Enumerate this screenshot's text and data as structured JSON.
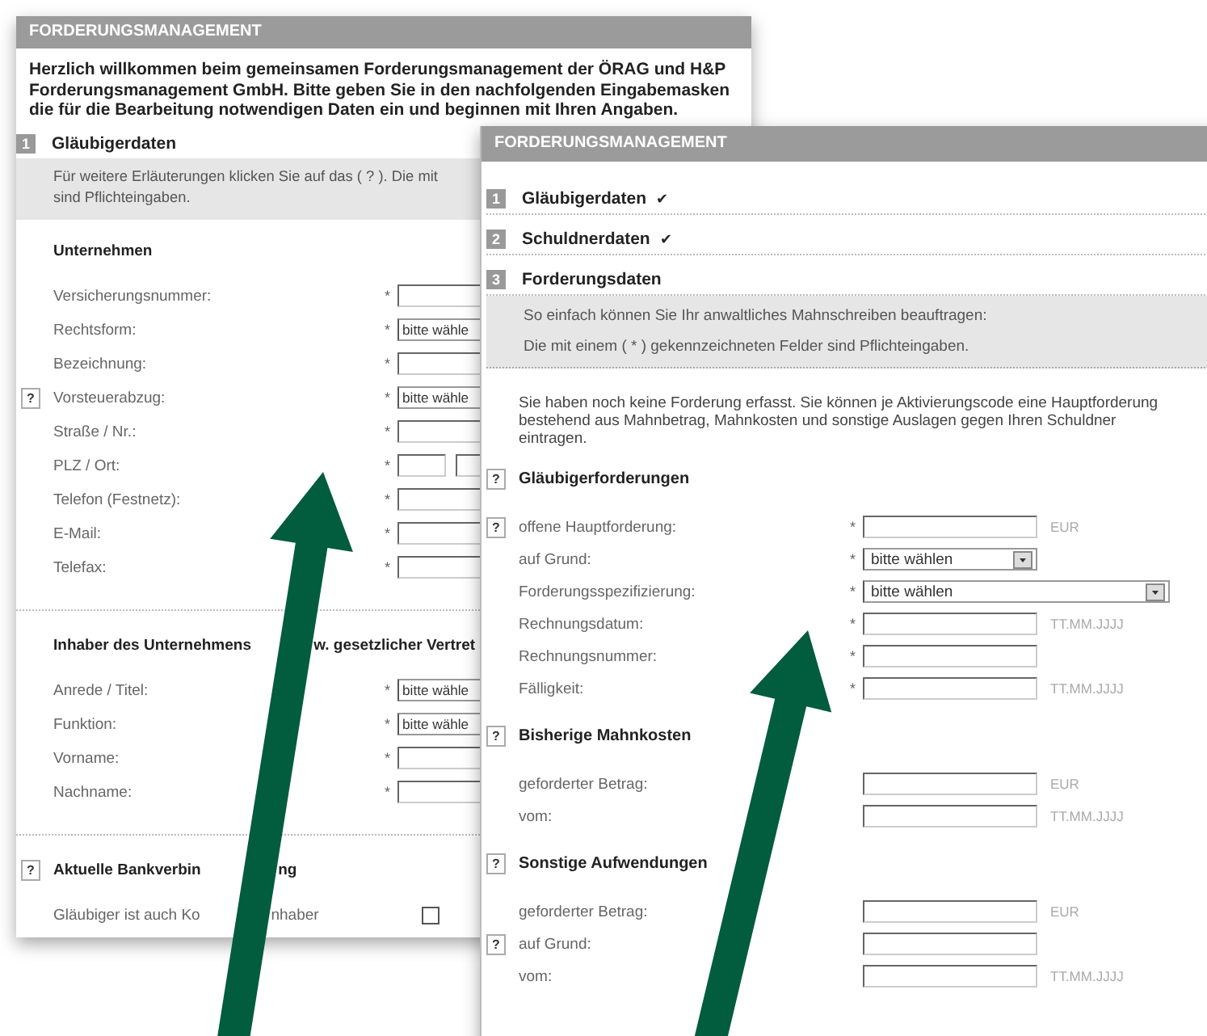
{
  "left_window": {
    "title": "FORDERUNGSMANAGEMENT",
    "intro_lines": [
      "Herzlich willkommen beim gemeinsamen Forderungsmanagement der ÖRAG und H&P",
      "Forderungsmanagement GmbH. Bitte geben Sie in den nachfolgenden Eingabemasken",
      "die für die Bearbeitung notwendigen Daten ein und beginnen mit Ihren Angaben."
    ],
    "step": {
      "number": "1",
      "label": "Gläubigerdaten"
    },
    "info_lines": [
      "Für weitere Erläuterungen klicken Sie auf das ( ? ). Die mit",
      "sind Pflichteingaben."
    ],
    "sections": [
      {
        "title": [
          "Unternehmen"
        ],
        "rows": [
          {
            "label": [
              "Versicherungsnummer:"
            ],
            "marker": "*",
            "kind": "text"
          },
          {
            "label": [
              "Rechtsform:"
            ],
            "marker": "*",
            "kind": "select",
            "value": "bitte wähle"
          },
          {
            "label": [
              "Bezeichnung:"
            ],
            "marker": "*",
            "kind": "text"
          },
          {
            "label": [
              "Vorsteuerabzug:"
            ],
            "help": "?",
            "marker": "*",
            "kind": "select",
            "value": "bitte wähle"
          },
          {
            "label": [
              "Straße / Nr.:"
            ],
            "marker": "*",
            "kind": "text"
          },
          {
            "label": [
              "PLZ / Ort:"
            ],
            "marker": "*",
            "kind": "split"
          },
          {
            "label": [
              "Telefon (Festnetz):"
            ],
            "marker": "*",
            "kind": "text"
          },
          {
            "label": [
              "E-Mail:"
            ],
            "marker": "*",
            "kind": "text"
          },
          {
            "label": [
              "Telefax:"
            ],
            "marker": "*",
            "kind": "text"
          }
        ]
      },
      {
        "title": [
          "Inhaber des Unternehmens",
          "w. gesetzlicher Vertret"
        ],
        "rows": [
          {
            "label": [
              "Anrede / Titel:"
            ],
            "marker": "*",
            "kind": "select",
            "value": "bitte wähle"
          },
          {
            "label": [
              "Funktion:"
            ],
            "marker": "*",
            "kind": "select",
            "value": "bitte wähle"
          },
          {
            "label": [
              "Vorname:"
            ],
            "marker": "*",
            "kind": "text"
          },
          {
            "label": [
              "Nachname:"
            ],
            "marker": "*",
            "kind": "text"
          }
        ]
      },
      {
        "title": [
          "Aktuelle Bankverbin",
          "ng"
        ],
        "help": "?",
        "rows": [
          {
            "label": [
              "Gläubiger ist auch Ko",
              "nhaber"
            ],
            "kind": "checkbox",
            "checked": false
          }
        ]
      }
    ]
  },
  "right_window": {
    "title": "FORDERUNGSMANAGEMENT",
    "steps": [
      {
        "number": "1",
        "label": "Gläubigerdaten",
        "mark": "✔"
      },
      {
        "number": "2",
        "label": "Schuldnerdaten",
        "mark": "✔"
      },
      {
        "number": "3",
        "label": "Forderungsdaten"
      }
    ],
    "info_lines": [
      "So einfach können Sie Ihr anwaltliches Mahnschreiben beauftragen:",
      "Die mit einem ( * ) gekennzeichneten Felder sind Pflichteingaben."
    ],
    "notice": "Sie haben noch keine Forderung erfasst. Sie können je Aktivierungscode eine Hauptforderung bestehend aus Mahnbetrag, Mahnkosten und sonstige Auslagen gegen Ihren Schuldner eintragen.",
    "sections": [
      {
        "title": [
          "Gläubigerforderungen"
        ],
        "help": "?",
        "rows": [
          {
            "label": [
              "offene Hauptforderung:"
            ],
            "help": "?",
            "marker": "*",
            "kind": "text",
            "suffix": "EUR"
          },
          {
            "label": [
              "auf Grund:"
            ],
            "marker": "*",
            "kind": "select",
            "value": "bitte wählen"
          },
          {
            "label": [
              "Forderungsspezifizierung:"
            ],
            "marker": "*",
            "kind": "wideselect",
            "value": "bitte wählen"
          },
          {
            "label": [
              "Rechnungsdatum:"
            ],
            "marker": "*",
            "kind": "text",
            "suffix": "TT.MM.JJJJ"
          },
          {
            "label": [
              "Rechnungsnummer:"
            ],
            "marker": "*",
            "kind": "text"
          },
          {
            "label": [
              "Fälligkeit:"
            ],
            "marker": "*",
            "kind": "text",
            "suffix": "TT.MM.JJJJ"
          }
        ]
      },
      {
        "title": [
          "Bisherige Mahnkosten"
        ],
        "help": "?",
        "rows": [
          {
            "label": [
              "geforderter Betrag:"
            ],
            "kind": "text",
            "suffix": "EUR"
          },
          {
            "label": [
              "vom:"
            ],
            "kind": "text",
            "suffix": "TT.MM.JJJJ"
          }
        ]
      },
      {
        "title": [
          "Sonstige Aufwendungen"
        ],
        "help": "?",
        "rows": [
          {
            "label": [
              "geforderter Betrag:"
            ],
            "kind": "text",
            "suffix": "EUR"
          },
          {
            "label": [
              "auf Grund:"
            ],
            "help": "?",
            "kind": "text"
          },
          {
            "label": [
              "vom:"
            ],
            "kind": "text",
            "suffix": "TT.MM.JJJJ"
          }
        ]
      }
    ]
  }
}
